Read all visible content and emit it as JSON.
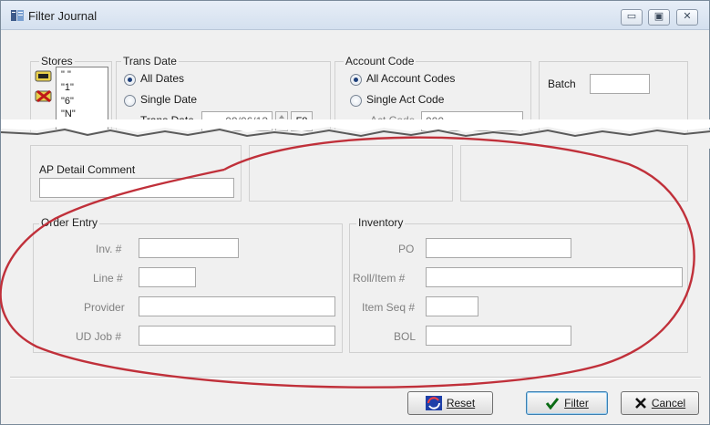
{
  "window": {
    "title": "Filter Journal"
  },
  "title_buttons": {
    "minimize": "▭",
    "maximize": "▣",
    "close": "✕"
  },
  "stores": {
    "label": "Stores",
    "items": [
      "\" \"",
      "\"1\"",
      "\"6\"",
      "\"N\""
    ]
  },
  "trans_date": {
    "label": "Trans Date",
    "all_dates": "All Dates",
    "single_date": "Single Date",
    "field_label": "Trans Date",
    "value": "09/06/13",
    "f8": "F8",
    "selected": "all_dates"
  },
  "account_code": {
    "label": "Account Code",
    "all_codes": "All Account Codes",
    "single_code": "Single Act Code",
    "field_label": "Act Code",
    "value": "000",
    "selected": "all_codes"
  },
  "batch": {
    "label": "Batch",
    "value": ""
  },
  "ap_detail": {
    "label": "AP Detail Comment",
    "value": ""
  },
  "order_entry": {
    "label": "Order Entry",
    "inv_label": "Inv. #",
    "line_label": "Line #",
    "provider_label": "Provider",
    "udjob_label": "UD Job #"
  },
  "inventory": {
    "label": "Inventory",
    "po_label": "PO",
    "rollitem_label": "Roll/Item #",
    "itemseq_label": "Item Seq #",
    "bol_label": "BOL"
  },
  "buttons": {
    "reset": "Reset",
    "filter": "Filter",
    "cancel": "Cancel"
  },
  "colors": {
    "annotation": "#c0303a",
    "accent": "#1d3f7a"
  }
}
